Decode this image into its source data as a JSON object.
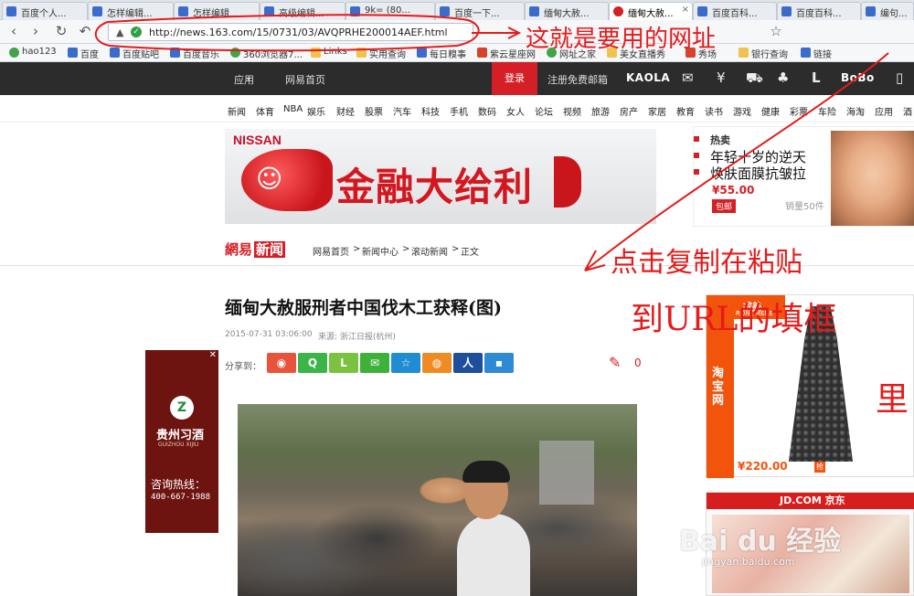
{
  "browser": {
    "tabs": [
      {
        "label": "百度个人..."
      },
      {
        "label": "怎样编辑..."
      },
      {
        "label": "怎样编辑..."
      },
      {
        "label": "高级编辑..."
      },
      {
        "label": "9k= (80..."
      },
      {
        "label": "百度一下..."
      },
      {
        "label": "缅甸大赦..."
      },
      {
        "label": "缅甸大赦..."
      },
      {
        "label": "百度百科..."
      },
      {
        "label": "百度百科..."
      },
      {
        "label": "编句..."
      }
    ],
    "url": "http://news.163.com/15/0731/03/AVQPRHE200014AEF.html",
    "bookmarks": [
      "hao123",
      "百度",
      "百度贴吧",
      "百度音乐",
      "360浏览器7...",
      "Links",
      "实用查询",
      "每日糗事",
      "紫云星座网",
      "网址之家",
      "美女直播秀",
      "秀场",
      "银行查询",
      "链接"
    ]
  },
  "header": {
    "apps": "应用",
    "home": "网易首页",
    "login": "登录",
    "register": "注册免费邮箱",
    "kaola": "KAOLA",
    "user": "BoBo"
  },
  "channels": [
    "新闻",
    "体育",
    "NBA",
    "娱乐",
    "财经",
    "股票",
    "汽车",
    "科技",
    "手机",
    "数码",
    "女人",
    "论坛",
    "视频",
    "旅游",
    "房产",
    "家居",
    "教育",
    "读书",
    "游戏",
    "健康",
    "彩票",
    "车险",
    "海淘",
    "应用",
    "酒"
  ],
  "banner": {
    "brand": "NISSAN",
    "slogan": "金融大给利"
  },
  "hot": {
    "label": "热卖",
    "line1": "年轻十岁的逆天",
    "line2": "焕肤面膜抗皱拉",
    "price": "¥55.00",
    "buy": "包邮",
    "sold": "销量50件"
  },
  "article": {
    "logo": "網易",
    "logo_news": "新闻",
    "crumbs": [
      "网易首页",
      "新闻中心",
      "滚动新闻",
      "正文"
    ],
    "title": "缅甸大赦服刑者中国伐木工获释(图)",
    "time": "2015-07-31 03:06:00",
    "source": "来源: 浙江日报(杭州)",
    "share_label": "分享到：",
    "comments": "0"
  },
  "left_ad": {
    "brand": "贵州习酒",
    "sub": "GUIZHOU XIJIU",
    "hotline": "咨询热线：",
    "phone": "400-667-1988"
  },
  "taobao_ad": {
    "label": "淘宝网",
    "brand": "戎美",
    "brand_en": "RONGMERE",
    "price": "¥220.00"
  },
  "jd_ad": {
    "label": "JD.COM 京东"
  },
  "watermark": {
    "main": "Bai du 经验",
    "url": "jingyan.baidu.com"
  },
  "annotations": {
    "note1": "这就是要用的网址",
    "note2": "点击复制在粘贴",
    "note3": "到URL的填框",
    "note4": "里"
  },
  "colors": {
    "netease_red": "#d41f26",
    "annotation_red": "#e51b1b",
    "taobao_orange": "#f3540c"
  }
}
